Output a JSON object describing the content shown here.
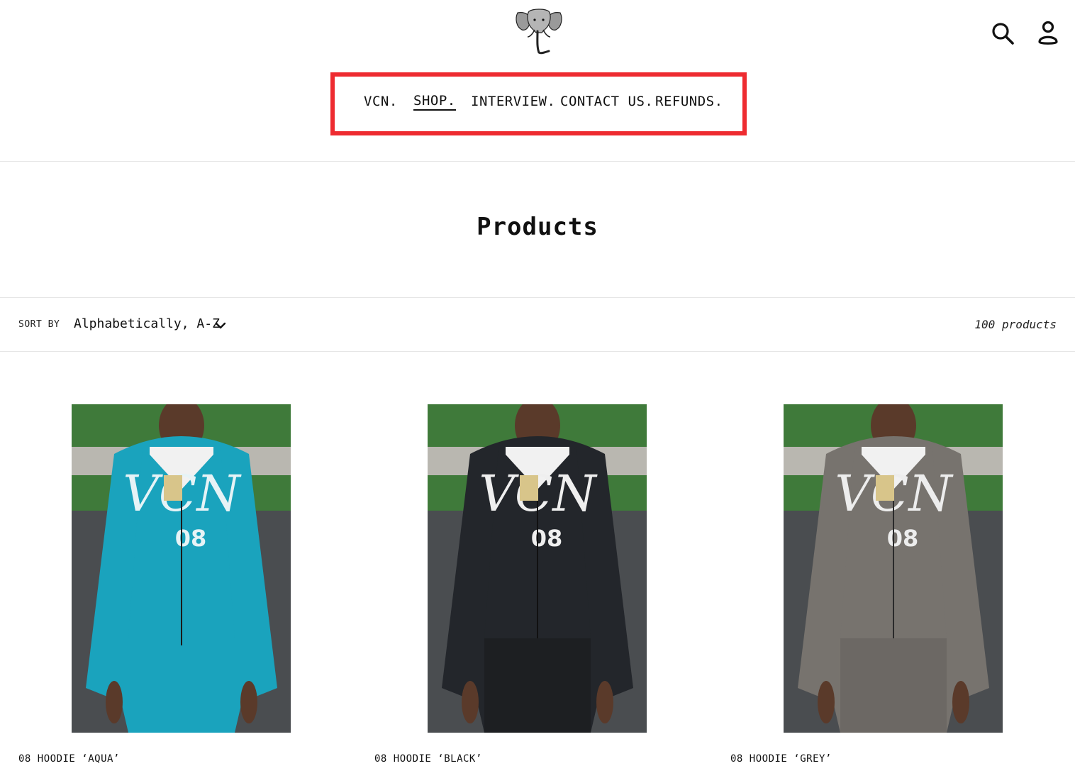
{
  "nav": {
    "items": [
      {
        "label": "VCN."
      },
      {
        "label": "SHOP."
      },
      {
        "label": "INTERVIEW."
      },
      {
        "label": "CONTACT US."
      },
      {
        "label": "REFUNDS."
      }
    ],
    "active": "SHOP."
  },
  "header": {
    "logo_icon": "elephant-logo",
    "icons": [
      "search-icon",
      "account-icon"
    ]
  },
  "page": {
    "title": "Products"
  },
  "filter": {
    "sort_label": "SORT BY",
    "sort_value": "Alphabetically, A-Z",
    "product_count": "100 products"
  },
  "products": [
    {
      "name": "08 HOODIE ‘AQUA’",
      "color": "#1aa3bd"
    },
    {
      "name": "08 HOODIE ‘BLACK’",
      "color": "#23262b"
    },
    {
      "name": "08 HOODIE ‘GREY’",
      "color": "#77736e"
    }
  ],
  "colors": {
    "accent_highlight": "#ee2b30",
    "text": "#111111",
    "divider": "#e6e6e6"
  }
}
